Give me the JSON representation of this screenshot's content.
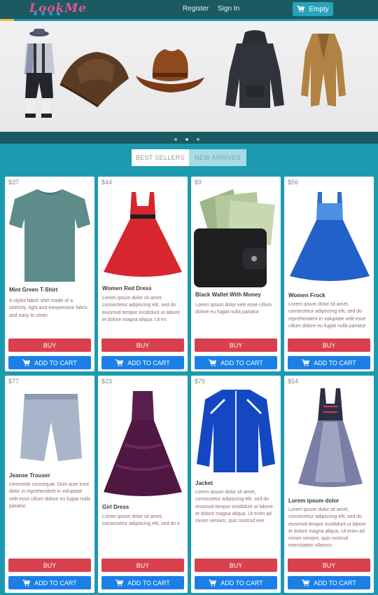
{
  "header": {
    "logo_text": "LookMe",
    "register_label": "Register",
    "signin_label": "Sign In",
    "cart_label": "Empty",
    "cart_icon": "shopping-cart-icon"
  },
  "carousel": {
    "slides": [
      "lederhosen-outfit",
      "pirate-leather-hat",
      "cowboy-hat",
      "black-hoodie",
      "tan-tailcoat"
    ],
    "active_indicator": 2,
    "indicator_count": 3
  },
  "tabs": [
    {
      "label": "BEST SELLERS",
      "active": true
    },
    {
      "label": "NEW ARRIVES",
      "active": false
    }
  ],
  "buttons": {
    "buy_label": "BUY",
    "add_label": "ADD TO CART"
  },
  "products": [
    {
      "price": "$37",
      "name": "Mint Green T-Shirt",
      "desc": "A stylist fabric shirt made of a stretchy, light and inexpensive fabric and easy to clean"
    },
    {
      "price": "$44",
      "name": "Women Red Dress",
      "desc": "Lorem ipsum dolor sit amet, consectetur adipiscing elit, sed do eiusmod tempor incididunt ut labore et dolore magna aliqua. Ut en"
    },
    {
      "price": "$9",
      "name": "Black Wallet With Money",
      "desc": "Lorem ipsum dolor velit esse cillum dolore eu fugiat nulla pariatur"
    },
    {
      "price": "$56",
      "name": "Women Frock",
      "desc": "Lorem ipsum dolor sit amet, consectetur adipiscing elit, sed do reprehenderit in voluptate velit esse cillum dolore eu fugiat nulla pariatur"
    },
    {
      "price": "$77",
      "name": "Jeanse Trouser",
      "desc": "commodo consequat. Duis aute irure dolor in reprehenderit in voluptate velit esse cillum dolore eu fugiat nulla pariatur"
    },
    {
      "price": "$23",
      "name": "Girl Dress",
      "desc": "Lorem ipsum dolor sit amet, consectetur adipiscing elit, sed do e"
    },
    {
      "price": "$79",
      "name": "Jacket",
      "desc": "Lorem ipsum dolor sit amet, consectetur adipiscing elit, sed do eiusmod tempor incididunt ut labore et dolore magna aliqua. Ut enim ad minim veniam, quis nostrud exe"
    },
    {
      "price": "$54",
      "name": "Lorem ipsum dolor",
      "desc": "Lorem ipsum dolor sit amet, consectetur adipiscing elit, sed do eiusmod tempor incididunt ut labore et dolore magna aliqua. Ut enim ad minim veniam, quis nostrud exercitation ullamco"
    }
  ],
  "colors": {
    "page_bg": "#1e9ab0",
    "navbar": "#1c5a62",
    "buy": "#d9404e",
    "add_to_cart": "#1b7fe6"
  }
}
